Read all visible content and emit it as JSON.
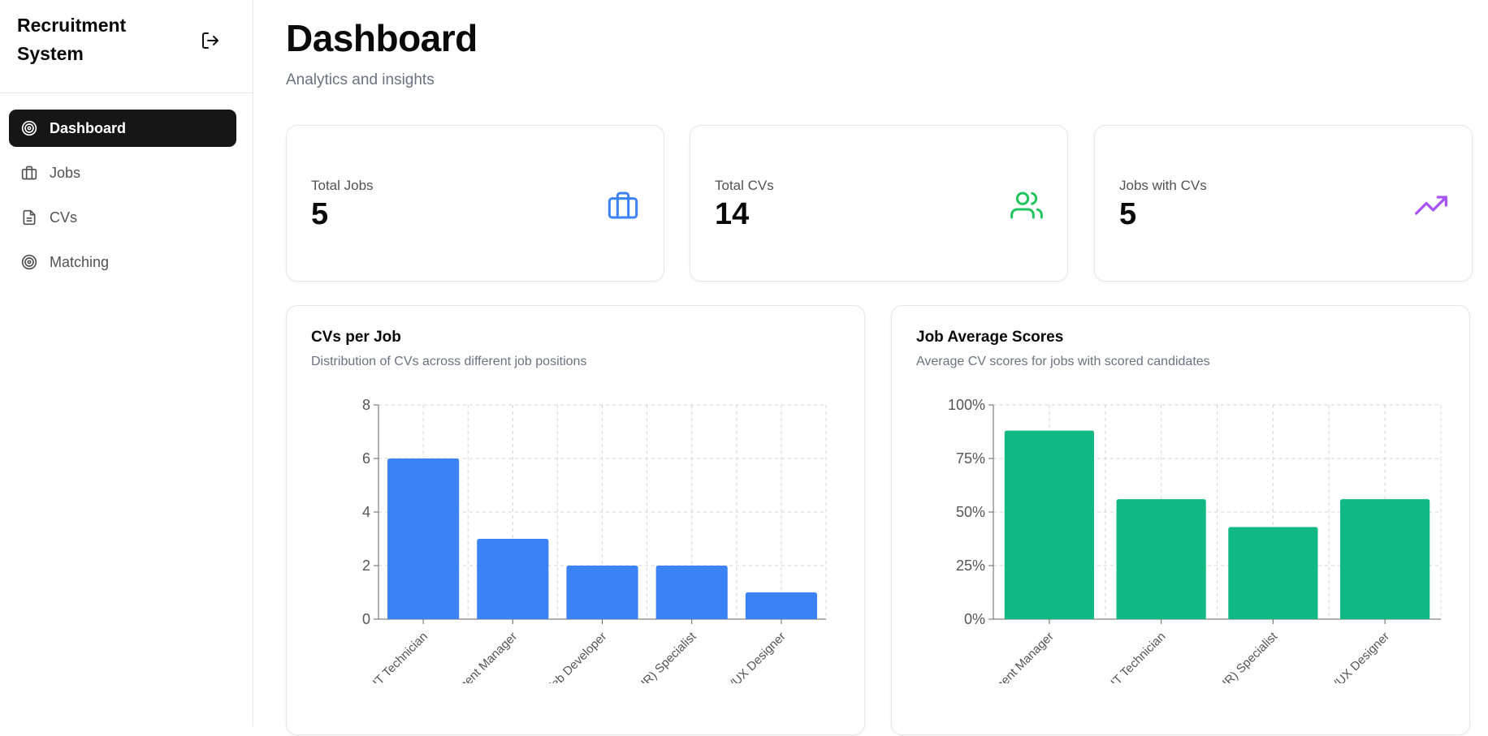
{
  "app": {
    "title": "Recruitment System"
  },
  "sidebar": {
    "items": [
      {
        "label": "Dashboard",
        "icon": "target-icon",
        "active": true
      },
      {
        "label": "Jobs",
        "icon": "briefcase-icon",
        "active": false
      },
      {
        "label": "CVs",
        "icon": "file-text-icon",
        "active": false
      },
      {
        "label": "Matching",
        "icon": "target-icon",
        "active": false
      }
    ]
  },
  "header": {
    "title": "Dashboard",
    "subtitle": "Analytics and insights"
  },
  "stats": [
    {
      "label": "Total Jobs",
      "value": "5",
      "icon": "briefcase-icon",
      "color": "#3b82f6"
    },
    {
      "label": "Total CVs",
      "value": "14",
      "icon": "users-icon",
      "color": "#22c55e"
    },
    {
      "label": "Jobs with CVs",
      "value": "5",
      "icon": "trending-up-icon",
      "color": "#a855f7"
    }
  ],
  "chart_data": [
    {
      "type": "bar",
      "title": "CVs per Job",
      "subtitle": "Distribution of CVs across different job positions",
      "categories": [
        "IT Technician",
        "Development Manager",
        "Web Developer",
        "Human Resources (HR) Specialist",
        "UI/UX Designer"
      ],
      "values": [
        6,
        3,
        2,
        2,
        1
      ],
      "ylim": [
        0,
        8
      ],
      "yticks": [
        "0",
        "2",
        "4",
        "6",
        "8"
      ],
      "color": "#3b82f6",
      "grid": true
    },
    {
      "type": "bar",
      "title": "Job Average Scores",
      "subtitle": "Average CV scores for jobs with scored candidates",
      "categories": [
        "Development Manager",
        "IT Technician",
        "Human Resources (HR) Specialist",
        "UI/UX Designer"
      ],
      "values": [
        0.88,
        0.56,
        0.43,
        0.56
      ],
      "ylim": [
        0,
        1
      ],
      "yticks": [
        "0%",
        "25%",
        "50%",
        "75%",
        "100%"
      ],
      "color": "#10b981",
      "grid": true
    }
  ]
}
